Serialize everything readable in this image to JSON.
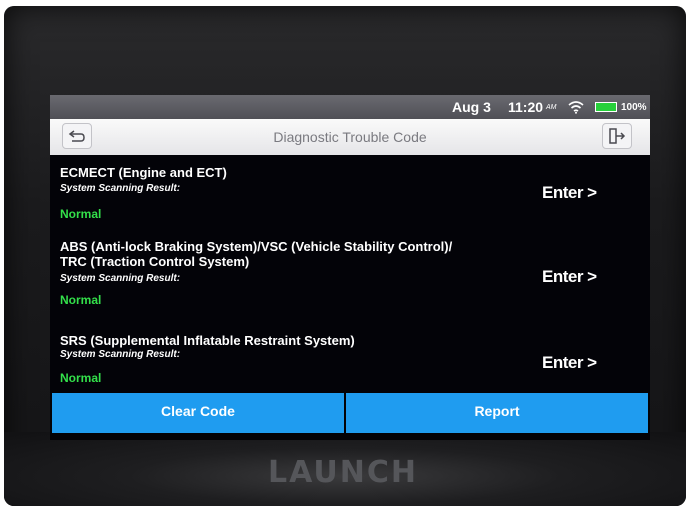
{
  "device": {
    "brand": "LAUNCH"
  },
  "statusbar": {
    "date": "Aug 3",
    "time": "11:20",
    "ampm": "AM",
    "battery": "100%",
    "battery_color": "#27d13b"
  },
  "header": {
    "title": "Diagnostic Trouble Code",
    "back_icon": "back-arrow-icon",
    "exit_icon": "exit-icon"
  },
  "systems": [
    {
      "title_lines": [
        "ECMECT (Engine and ECT)"
      ],
      "result_label": "System Scanning Result:",
      "status": "Normal",
      "enter_label": "Enter >"
    },
    {
      "title_lines": [
        "ABS (Anti-lock Braking System)/VSC (Vehicle Stability Control)/",
        "TRC (Traction Control System)"
      ],
      "result_label": "System Scanning Result:",
      "status": "Normal",
      "enter_label": "Enter >"
    },
    {
      "title_lines": [
        "SRS (Supplemental Inflatable Restraint System)"
      ],
      "result_label": "System Scanning Result:",
      "status": "Normal",
      "enter_label": "Enter >"
    }
  ],
  "actions": {
    "clear_label": "Clear Code",
    "report_label": "Report",
    "button_color": "#1f9cf0"
  },
  "colors": {
    "normal_status": "#33e04a"
  }
}
